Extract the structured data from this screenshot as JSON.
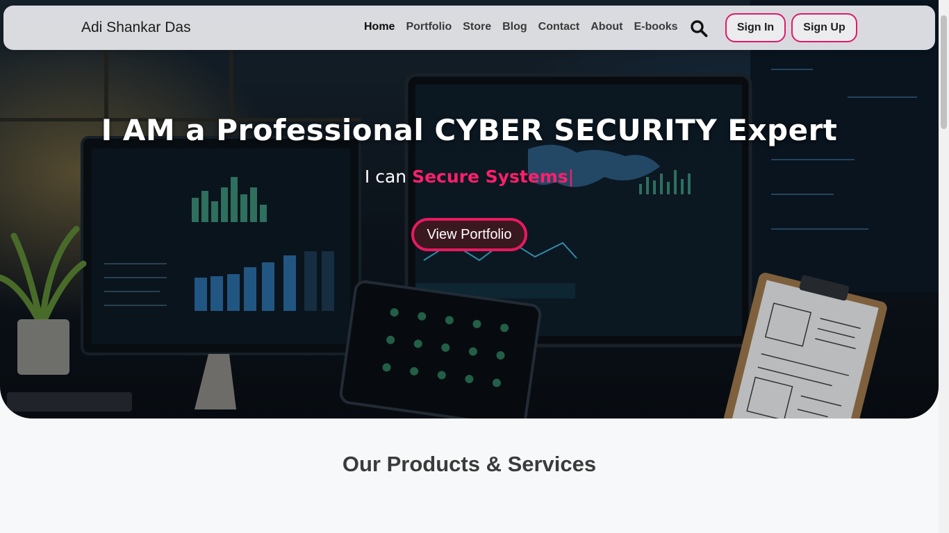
{
  "nav": {
    "brand": "Adi Shankar Das",
    "links": [
      "Home",
      "Portfolio",
      "Store",
      "Blog",
      "Contact",
      "About",
      "E-books"
    ],
    "active_link": "Home",
    "search_icon": "search-icon",
    "signin_label": "Sign In",
    "signup_label": "Sign Up"
  },
  "hero": {
    "title": "I AM a Professional CYBER SECURITY Expert",
    "subtitle_prefix": "I can",
    "typed_text": "Secure Systems",
    "caret": "|",
    "cta_label": "View Portfolio"
  },
  "section": {
    "title": "Our Products & Services"
  },
  "colors": {
    "accent": "#e8195f",
    "typed_text": "#ff1f6c",
    "navbar_bg": "#e8eaee",
    "page_bg": "#f7f8fa"
  }
}
